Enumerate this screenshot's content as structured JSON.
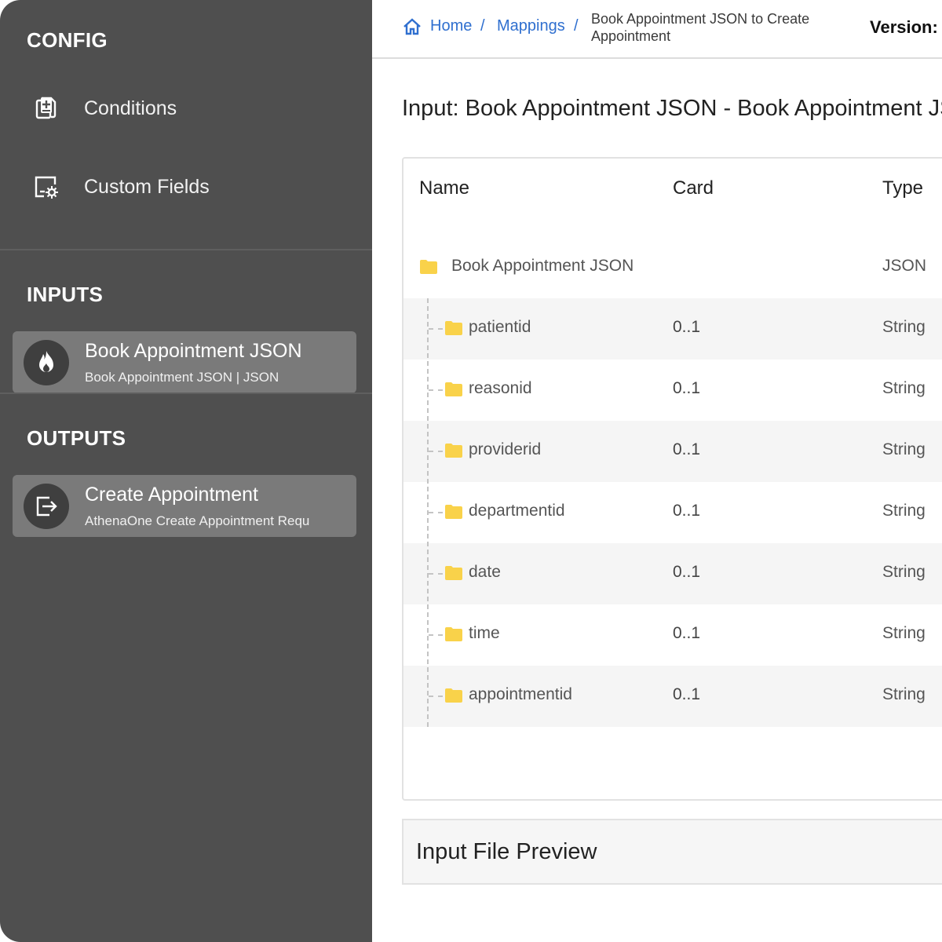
{
  "sidebar": {
    "config_title": "CONFIG",
    "config_items": [
      {
        "label": "Conditions",
        "icon": "document-add-icon"
      },
      {
        "label": "Custom Fields",
        "icon": "form-settings-icon"
      }
    ],
    "inputs_title": "INPUTS",
    "input_card": {
      "title": "Book Appointment JSON",
      "subtitle": "Book Appointment JSON | JSON",
      "icon": "flame-icon"
    },
    "outputs_title": "OUTPUTS",
    "output_card": {
      "title": "Create Appointment",
      "subtitle": "AthenaOne Create Appointment Requ",
      "icon": "export-icon"
    }
  },
  "header": {
    "breadcrumb": {
      "home": "Home",
      "sep": "/",
      "mappings": "Mappings",
      "current": "Book Appointment JSON to Create Appointment"
    },
    "version_label": "Version:"
  },
  "main": {
    "title": "Input: Book Appointment JSON - Book Appointment JSON",
    "table": {
      "columns": {
        "name": "Name",
        "card": "Card",
        "type": "Type"
      },
      "root": {
        "name": "Book Appointment JSON",
        "type": "JSON"
      },
      "rows": [
        {
          "name": "patientid",
          "card": "0..1",
          "type": "String"
        },
        {
          "name": "reasonid",
          "card": "0..1",
          "type": "String"
        },
        {
          "name": "providerid",
          "card": "0..1",
          "type": "String"
        },
        {
          "name": "departmentid",
          "card": "0..1",
          "type": "String"
        },
        {
          "name": "date",
          "card": "0..1",
          "type": "String"
        },
        {
          "name": "time",
          "card": "0..1",
          "type": "String"
        },
        {
          "name": "appointmentid",
          "card": "0..1",
          "type": "String"
        }
      ]
    },
    "preview_title": "Input File Preview"
  },
  "colors": {
    "sidebar_bg": "#4f4f4f",
    "card_bg": "#7a7a7a",
    "link": "#2f6fcf",
    "folder": "#f9d24a",
    "row_alt": "#f5f5f5"
  }
}
